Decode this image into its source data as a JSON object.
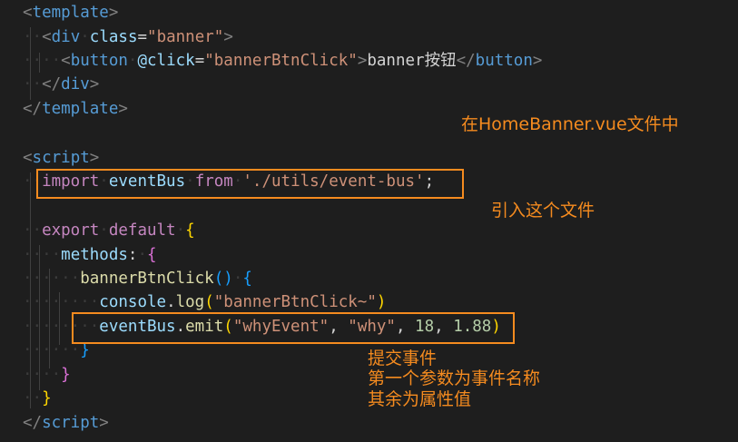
{
  "code": {
    "l1": {
      "open": "<",
      "tag": "template",
      "close": ">"
    },
    "l2": {
      "open": "<",
      "tag": "div",
      "attr": "class",
      "eq": "=",
      "val": "\"banner\"",
      "close": ">"
    },
    "l3": {
      "open": "<",
      "tag": "button",
      "attr": "@click",
      "eq": "=",
      "val": "\"bannerBtnClick\"",
      "close": ">",
      "text": "banner按钮",
      "end_open": "</",
      "end_tag": "button",
      "end_close": ">"
    },
    "l4": {
      "open": "</",
      "tag": "div",
      "close": ">"
    },
    "l5": {
      "open": "</",
      "tag": "template",
      "close": ">"
    },
    "l7": {
      "open": "<",
      "tag": "script",
      "close": ">"
    },
    "l8": {
      "kw1": "import",
      "id": "eventBus",
      "kw2": "from",
      "str": "'./utils/event-bus'",
      "semi": ";"
    },
    "l10": {
      "kw1": "export",
      "kw2": "default",
      "brace": "{"
    },
    "l11": {
      "name": "methods",
      "colon": ":",
      "brace": "{"
    },
    "l12": {
      "name": "bannerBtnClick",
      "paren": "()",
      "brace": "{"
    },
    "l13": {
      "obj": "console",
      "dot": ".",
      "fn": "log",
      "open": "(",
      "str": "\"bannerBtnClick~\"",
      "close": ")"
    },
    "l14": {
      "obj": "eventBus",
      "dot": ".",
      "fn": "emit",
      "open": "(",
      "a1": "\"whyEvent\"",
      "c1": ", ",
      "a2": "\"why\"",
      "c2": ", ",
      "a3": "18",
      "c3": ", ",
      "a4": "1.88",
      "close": ")"
    },
    "l15": {
      "brace": "}"
    },
    "l16": {
      "brace": "}"
    },
    "l17": {
      "brace": "}"
    },
    "l18": {
      "open": "</",
      "tag": "script",
      "close": ">"
    }
  },
  "annotations": {
    "file_note": "在HomeBanner.vue文件中",
    "import_note": "引入这个文件",
    "emit_note_1": "提交事件",
    "emit_note_2": "第一个参数为事件名称",
    "emit_note_3": "其余为属性值"
  },
  "colors": {
    "background": "#1e1e1e",
    "annotation": "#f58b1f",
    "tag": "#569cd6",
    "keyword": "#c586c0",
    "string": "#ce9178",
    "variable": "#9cdcfe",
    "function": "#dcdcaa",
    "number": "#b5cea8"
  }
}
